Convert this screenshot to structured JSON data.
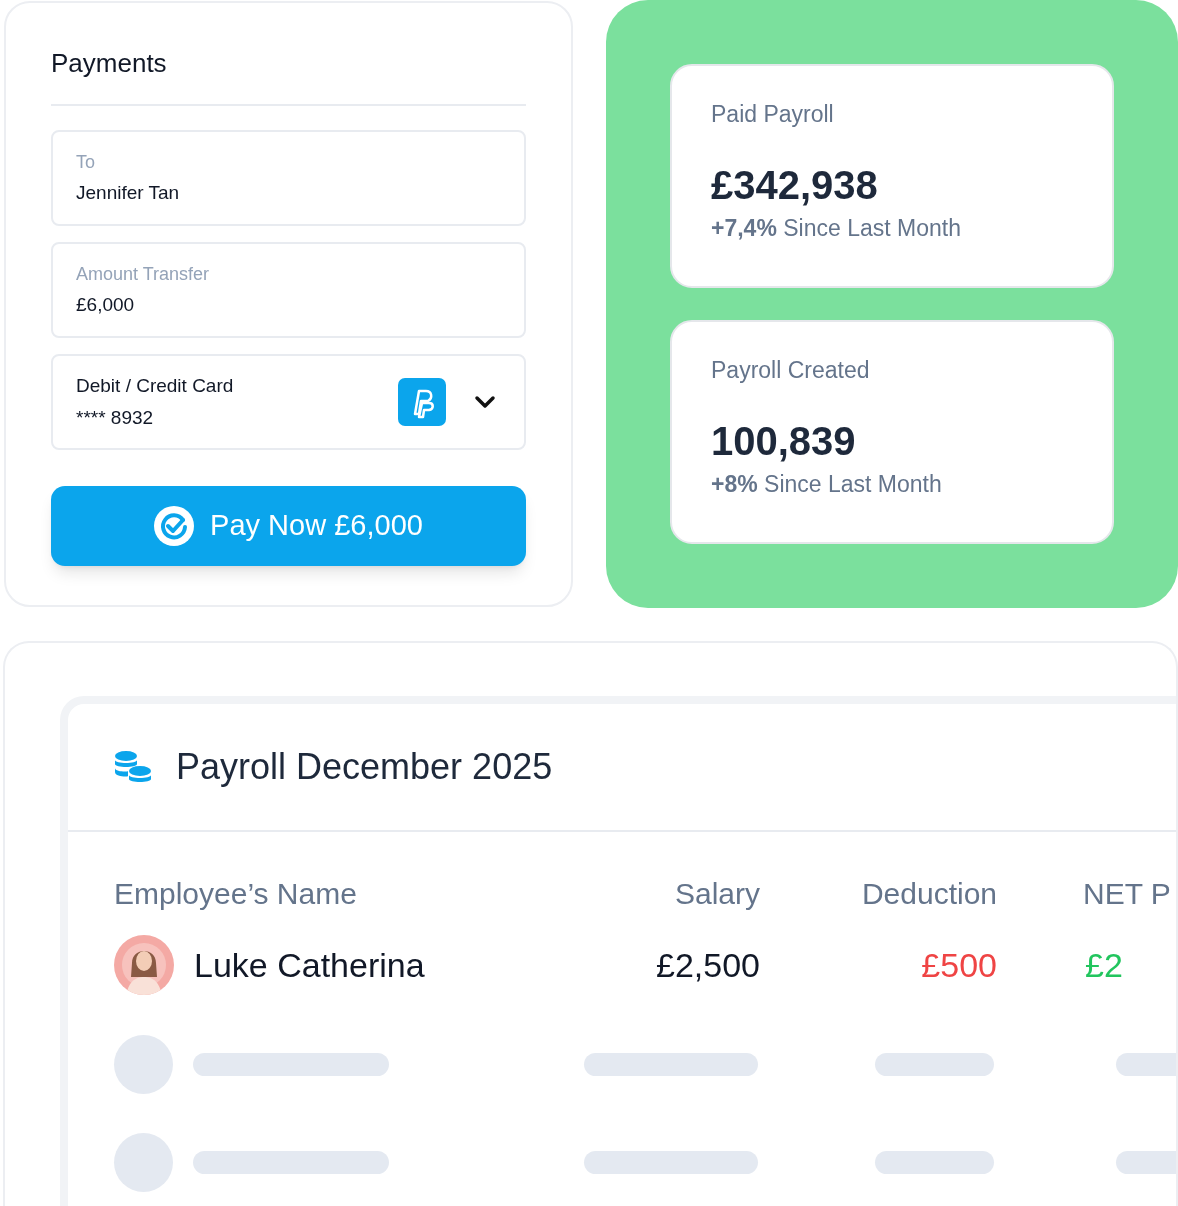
{
  "payments": {
    "title": "Payments",
    "fields": [
      {
        "kind": "text",
        "label": "To",
        "value": "Jennifer Tan"
      },
      {
        "kind": "text",
        "label": "Amount Transfer",
        "value": "£6,000"
      },
      {
        "kind": "select",
        "label": "Debit / Credit Card",
        "value": "**** 8932"
      }
    ],
    "button": "Pay Now £6,000"
  },
  "stats": [
    {
      "label": "Paid Payroll",
      "value": "£342,938",
      "change": "**+7,4%** Since Last Month"
    },
    {
      "label": "Payroll Created",
      "value": "100,839",
      "change": "**+8%** Since Last Month"
    }
  ],
  "payroll": {
    "title": "Payroll December 2025",
    "columns": [
      "Employee’s Name",
      "Salary",
      "Deduction",
      "NET P"
    ],
    "rows": [
      {
        "kind": "employee",
        "name": "Luke Catherina",
        "salary": "£2,500",
        "deduction": "£500",
        "net": "£2"
      },
      {
        "kind": "skeleton"
      },
      {
        "kind": "skeleton"
      }
    ]
  }
}
